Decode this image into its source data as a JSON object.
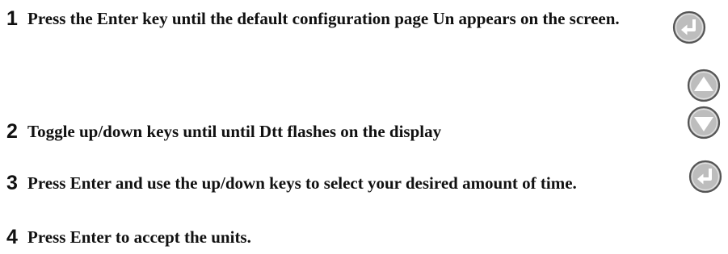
{
  "steps": [
    {
      "number": "1",
      "text": "Press the Enter key until the default configuration page Un appears on the screen.",
      "keys": [
        "enter-icon"
      ]
    },
    {
      "number": "2",
      "text": "Toggle up/down keys until until Dtt flashes on the display",
      "keys": [
        "up-arrow-icon",
        "down-arrow-icon"
      ]
    },
    {
      "number": "3",
      "text": "Press Enter and use the up/down keys to select your desired amount of time.",
      "keys": [
        "enter-icon"
      ]
    },
    {
      "number": "4",
      "text": "Press Enter to accept the units."
    }
  ],
  "colors": {
    "text": "#111111",
    "key_fill": "#bdbdbd",
    "key_rim": "#555555",
    "key_glyph": "#ffffff"
  }
}
